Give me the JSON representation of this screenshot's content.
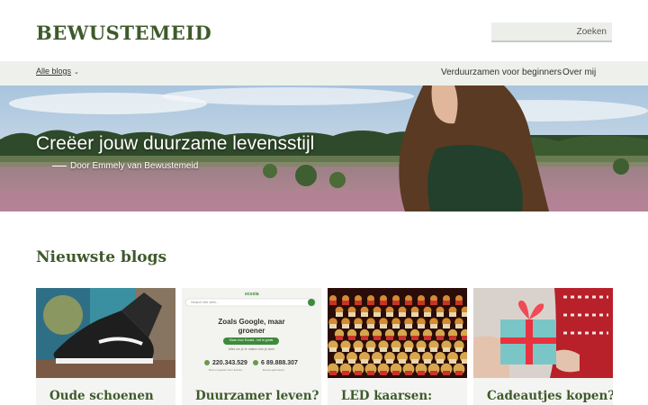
{
  "header": {
    "logo": "BEWUSTEMEID",
    "search_placeholder": "Zoeken"
  },
  "nav": {
    "blogs_label": "Alle blogs",
    "links": [
      "Verduurzamen voor beginners",
      "Over mij"
    ]
  },
  "hero": {
    "title": "Creëer jouw duurzame levensstijl",
    "subtitle": "Door Emmely van Bewustemeid"
  },
  "section": {
    "title": "Nieuwste blogs"
  },
  "cards": [
    {
      "title": "Oude schoenen"
    },
    {
      "title": "Duurzamer leven?",
      "image_text": {
        "logo": "ecosia",
        "search_placeholder": "Search the web...",
        "headline1": "Zoals Google, maar",
        "headline2": "groener",
        "button": "Klaar voor Ecosia - het is gratis",
        "sub": "Alles om je te maken kan je doen",
        "stat1": "220.343.529",
        "stat2": "6 89.888.307",
        "stat1_label": "Bomen geplant door Ecosia",
        "stat2_label": "Ecosia-gebruikers"
      }
    },
    {
      "title": "LED kaarsen:"
    },
    {
      "title": "Cadeautjes kopen?"
    }
  ],
  "colors": {
    "brand_green": "#3e5a2c",
    "nav_bg": "#eef0ec"
  }
}
